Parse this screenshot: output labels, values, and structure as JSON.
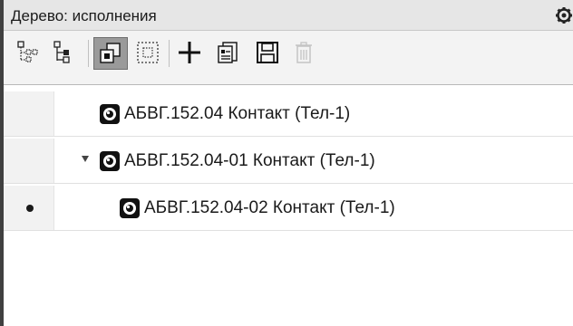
{
  "panel": {
    "title": "Дерево: исполнения",
    "settings_icon": "gear-icon"
  },
  "toolbar": {
    "buttons": [
      {
        "name": "tree-structure-icon",
        "active": false
      },
      {
        "name": "tree-list-icon",
        "active": false
      },
      {
        "name": "parts-icon",
        "active": true
      },
      {
        "name": "selection-frame-icon",
        "active": false
      },
      {
        "name": "add-icon",
        "active": false
      },
      {
        "name": "properties-icon",
        "active": false
      },
      {
        "name": "save-icon",
        "active": false
      },
      {
        "name": "delete-icon",
        "active": false,
        "disabled": true
      }
    ]
  },
  "tree": {
    "rows": [
      {
        "label": "АБВГ.152.04 Контакт (Тел-1)",
        "level": 0,
        "expanded": false,
        "current": false
      },
      {
        "label": "АБВГ.152.04-01 Контакт (Тел-1)",
        "level": 0,
        "expanded": true,
        "current": false
      },
      {
        "label": "АБВГ.152.04-02 Контакт (Тел-1)",
        "level": 1,
        "expanded": false,
        "current": true
      }
    ]
  }
}
